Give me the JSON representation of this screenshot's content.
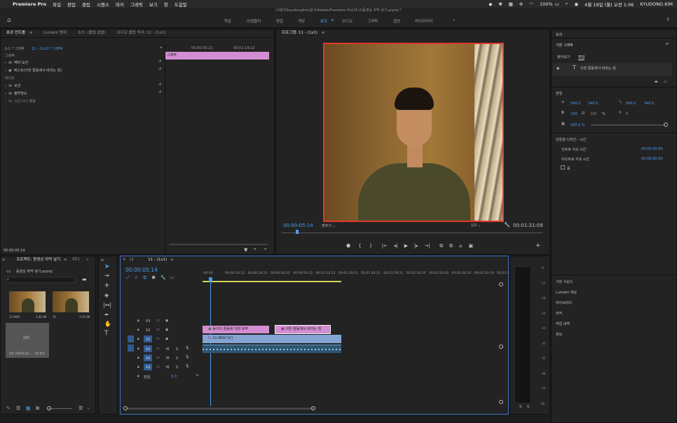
{
  "menubar": {
    "app": "Premiere Pro",
    "items": [
      "파일",
      "편집",
      "클립",
      "시퀀스",
      "마커",
      "그래픽",
      "보기",
      "창",
      "도움말"
    ],
    "battery": "100%",
    "datetime": "4월 19일 (월) 오전 1:06",
    "user": "KYUDONG KIM"
  },
  "window_title": "/사용자/kyudongkim/문서/Adobe/Premiere Pro/15.0/동영상 자막 넣기.prproj *",
  "workspaces": [
    "학습",
    "어셈블리",
    "편집",
    "색상",
    "효과",
    "오디오",
    "그래픽",
    "캡션",
    "라이브러리"
  ],
  "active_workspace": "효과",
  "effect_controls": {
    "tabs": [
      "효과 컨트롤",
      "Lumetri 범위",
      "소스: (클립 없음)",
      "오디오 클립 믹서: 11 - (1x1)"
    ],
    "source_label": "소스 * 그래픽",
    "sequence_label": "11 - (1x1) * 그래픽",
    "timecode_start": "00:00:05:22",
    "timecode_mid": "00:01:14:22",
    "clip_label": "그래픽",
    "sections": {
      "graphic": "그래픽",
      "video": "비디오"
    },
    "rows": [
      "벡터 모션",
      "텍스트(이번 활동에서 바라는 점)",
      "모션",
      "불투명도",
      "시간 다시 매핑"
    ],
    "current_time": "00:00:05:14"
  },
  "program": {
    "title": "프로그램: 11 - (1x1)",
    "timecode": "00:00:05:14",
    "fit": "맞추기",
    "quality": "1/2",
    "duration": "00:01:31:09"
  },
  "essential_graphics": {
    "header": "효과",
    "title": "기본 그래픽",
    "tabs": [
      "찾아보기",
      "편집"
    ],
    "layer": "이번 활동에서 바라는 점",
    "transform_label": "변형",
    "pos_x": "540.0",
    "pos_y": "540.0",
    "anchor_x": "540.0",
    "anchor_y": "540.0",
    "scale": "100",
    "scale_pct": "100",
    "unit_pct": "%",
    "rotation": "0",
    "opacity": "100.0 %",
    "responsive_title": "반응형 디자인 - 시간",
    "intro_label": "인트로 지속 시간",
    "intro_val": "00:00:00:00",
    "outro_label": "아웃트로 지속 시간",
    "outro_val": "00:00:00:00",
    "roll_label": "롤"
  },
  "side_panels": [
    "기본 사운드",
    "Lumetri 색상",
    "라이브러리",
    "마커",
    "작업 내역",
    "정보"
  ],
  "project": {
    "tabs": [
      "프로젝트: 동영상 자막 넣기",
      "미디"
    ],
    "file": "동영상 자막 넣기.prproj",
    "items": [
      {
        "name": "11.MOV",
        "dur": "1:31:09"
      },
      {
        "name": "11",
        "dur": "1:31:09"
      }
    ],
    "bin": "자동 저장(비디오...",
    "bin_count": "1개 항목"
  },
  "timeline": {
    "tabs": [
      "11",
      "11 - (1x1)"
    ],
    "timecode": "00:00:05:14",
    "ruler": [
      ":00:00",
      "00:00:14:23",
      "00:00:29:23",
      "00:00:44:22",
      "00:00:59:22",
      "00:01:14:22",
      "00:01:29:21",
      "00:01:44:21",
      "00:01:59:21",
      "00:02:14:20",
      "00:02:29:20",
      "00:02:44:20",
      "00:02:59:19",
      "00:03:1"
    ],
    "tracks_video": [
      "V3",
      "V2",
      "V1"
    ],
    "tracks_audio": [
      "A1",
      "A2",
      "A3"
    ],
    "mix_label": "혼합",
    "mix_value": "0.0",
    "clips": {
      "v2_a": "동아리 활동에 대한 포부",
      "v2_b": "이번 활동에서 바라는 점",
      "v1": "11.MOV [V]"
    }
  },
  "meter_scale": [
    "-6",
    "-12",
    "-18",
    "-24",
    "-30",
    "-36",
    "-42",
    "-48",
    "-54",
    "dB"
  ],
  "meter_solo": [
    "S",
    "S"
  ]
}
